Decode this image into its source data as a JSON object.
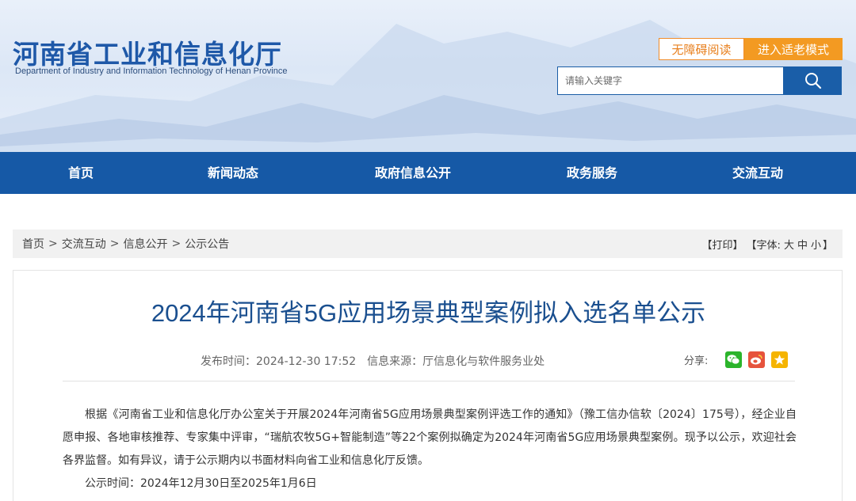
{
  "header": {
    "title": "河南省工业和信息化厅",
    "subtitle": "Department of Industry and Information Technology of Henan Province",
    "accessible_label": "无障碍阅读",
    "elder_mode_label": "进入适老模式",
    "search_placeholder": "请输入关键字"
  },
  "nav": {
    "items": [
      {
        "label": "首页"
      },
      {
        "label": "新闻动态"
      },
      {
        "label": "政府信息公开"
      },
      {
        "label": "政务服务"
      },
      {
        "label": "交流互动"
      }
    ]
  },
  "breadcrumb": {
    "items": [
      "首页",
      "交流互动",
      "信息公开",
      "公示公告"
    ],
    "separator": ">"
  },
  "tools": {
    "print": "【打印】",
    "font_label": "【字体:",
    "font_large": "大",
    "font_medium": "中",
    "font_small": "小",
    "close_bracket": "】"
  },
  "article": {
    "title": "2024年河南省5G应用场景典型案例拟入选名单公示",
    "publish_time": "发布时间：2024-12-30 17:52",
    "source": "信息来源：厅信息化与软件服务业处",
    "share_label": "分享:",
    "paragraph_1": "根据《河南省工业和信息化厅办公室关于开展2024年河南省5G应用场景典型案例评选工作的通知》（豫工信办信软〔2024〕175号），经企业自愿申报、各地审核推荐、专家集中评审，“瑞航农牧5G+智能制造”等22个案例拟确定为2024年河南省5G应用场景典型案例。现予以公示，欢迎社会各界监督。如有异议，请于公示期内以书面材料向省工业和信息化厅反馈。",
    "paragraph_2": "公示时间：2024年12月30日至2025年1月6日"
  },
  "icons": {
    "search": "search-icon",
    "wechat": "wechat-icon",
    "weibo": "weibo-icon",
    "favorite": "star-icon"
  },
  "colors": {
    "brand_blue": "#1659a6",
    "title_blue": "#1e58a8",
    "accent_orange": "#f39a22",
    "wechat_green": "#2bb42b",
    "weibo_red": "#e6533c",
    "star_yellow": "#f5b400"
  }
}
